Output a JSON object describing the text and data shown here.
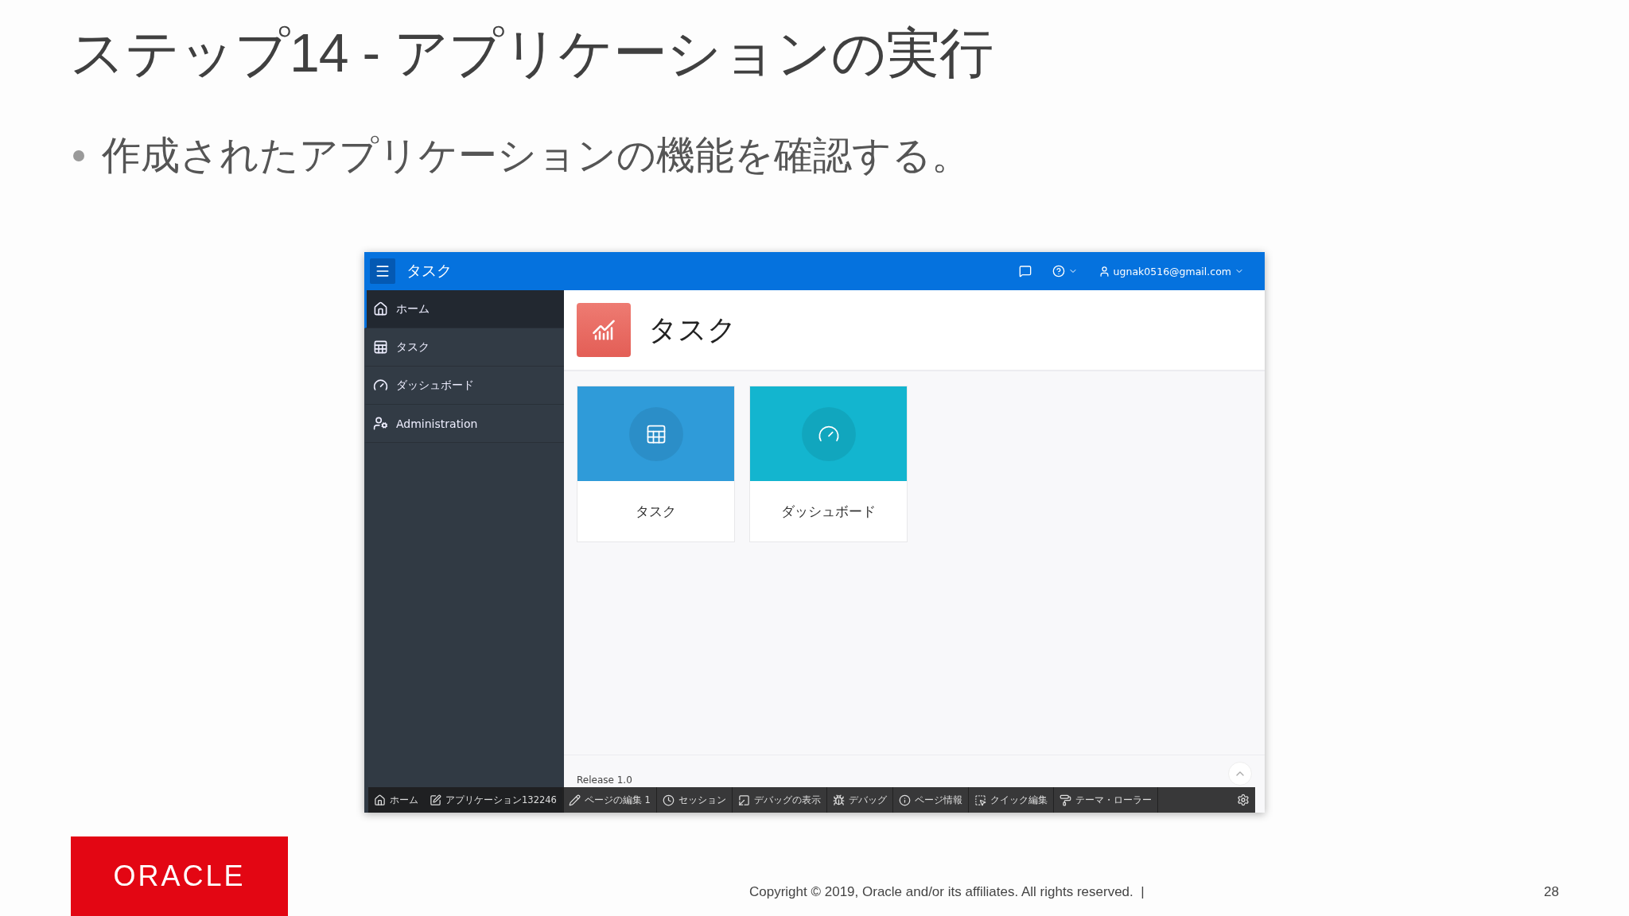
{
  "slide": {
    "title": "ステップ14 - アプリケーションの実行",
    "bullet": "作成されたアプリケーションの機能を確認する。"
  },
  "app": {
    "title": "タスク",
    "user": "ugnak0516@gmail.com",
    "sidebar": [
      {
        "label": "ホーム",
        "selected": true
      },
      {
        "label": "タスク",
        "selected": false
      },
      {
        "label": "ダッシュボード",
        "selected": false
      },
      {
        "label": "Administration",
        "selected": false
      }
    ],
    "page_title": "タスク",
    "cards": [
      {
        "label": "タスク",
        "color": "#2f9bd9"
      },
      {
        "label": "ダッシュボード",
        "color": "#13b5cf"
      }
    ],
    "footer": "Release 1.0",
    "dev_toolbar": [
      "ホーム",
      "アプリケーション132246",
      "ページの編集 1",
      "セッション",
      "デバッグの表示",
      "デバッグ",
      "ページ情報",
      "クイック編集",
      "テーマ・ローラー"
    ]
  },
  "footer": {
    "logo": "ORACLE",
    "copyright": "Copyright © 2019, Oracle and/or its affiliates. All rights reserved.  |",
    "page": "28"
  }
}
